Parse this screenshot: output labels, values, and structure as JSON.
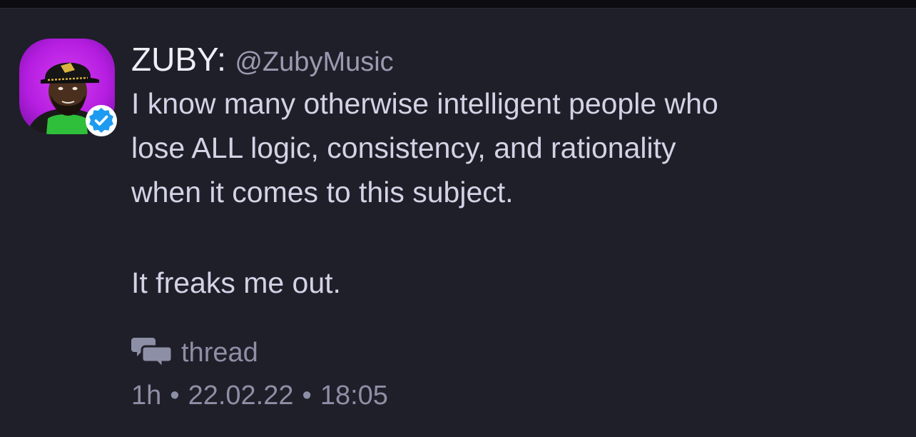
{
  "tweet": {
    "author_name": "ZUBY:",
    "handle": "@ZubyMusic",
    "verified": true,
    "lines": [
      "I know many otherwise intelligent people who",
      "lose ALL logic, consistency, and rationality",
      "when it comes to this subject.",
      "It freaks me out."
    ],
    "thread_label": "thread",
    "relative_time": "1h",
    "date": "22.02.22",
    "time": "18:05",
    "separator": "•"
  },
  "icons": {
    "avatar": "avatar",
    "verified": "verified-badge-icon",
    "thread": "speech-bubbles-icon"
  },
  "colors": {
    "background": "#1f1f29",
    "name": "#eeeef5",
    "body_text": "#d3d3e6",
    "muted": "#8d8fa6",
    "verified_blue": "#1d9bf0",
    "avatar_purple": "#b51ee0"
  }
}
